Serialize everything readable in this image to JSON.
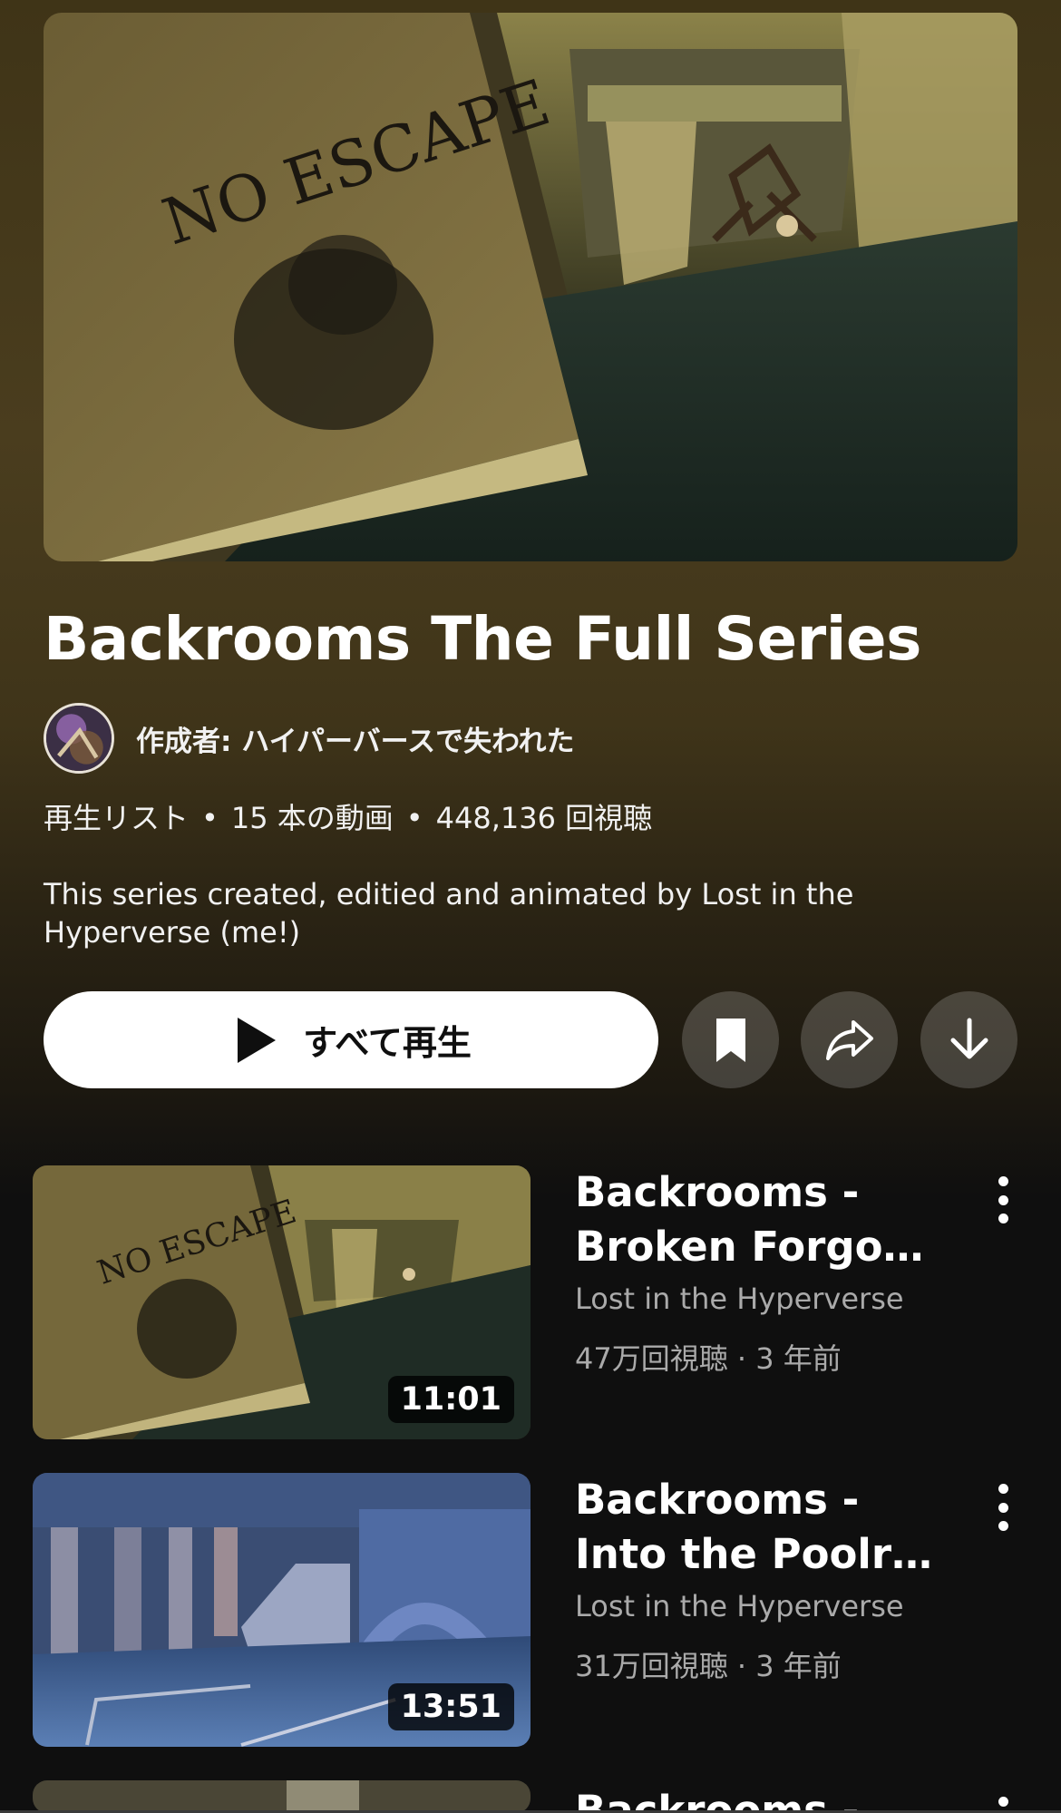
{
  "playlist": {
    "title": "Backrooms The Full Series",
    "owner": "作成者: ハイパーバースで失われた",
    "meta_type": "再生リスト",
    "meta_count": "15 本の動画",
    "meta_views": "448,136 回視聴",
    "meta_separator": "•",
    "description": "This series created, editied and animated by Lost in the Hyperverse (me!)",
    "thumbnail_text": "NO ESCAPE"
  },
  "actions": {
    "play_all_label": "すべて再生",
    "icons": [
      "play-icon",
      "bookmark-icon",
      "share-icon",
      "download-icon"
    ]
  },
  "videos": [
    {
      "title": "Backrooms - Broken Forgo…",
      "channel": "Lost in the Hyperverse",
      "stats": "47万回視聴 · 3 年前",
      "duration": "11:01",
      "thumbnail_text": "NO ESCAPE"
    },
    {
      "title": "Backrooms - Into the Poolr…",
      "channel": "Lost in the Hyperverse",
      "stats": "31万回視聴 · 3 年前",
      "duration": "13:51"
    },
    {
      "title": "Backrooms -"
    }
  ],
  "colors": {
    "background": "#0f0f0f",
    "header_gradient": "#4a3d1e",
    "secondary_text": "#aaaaaa"
  }
}
